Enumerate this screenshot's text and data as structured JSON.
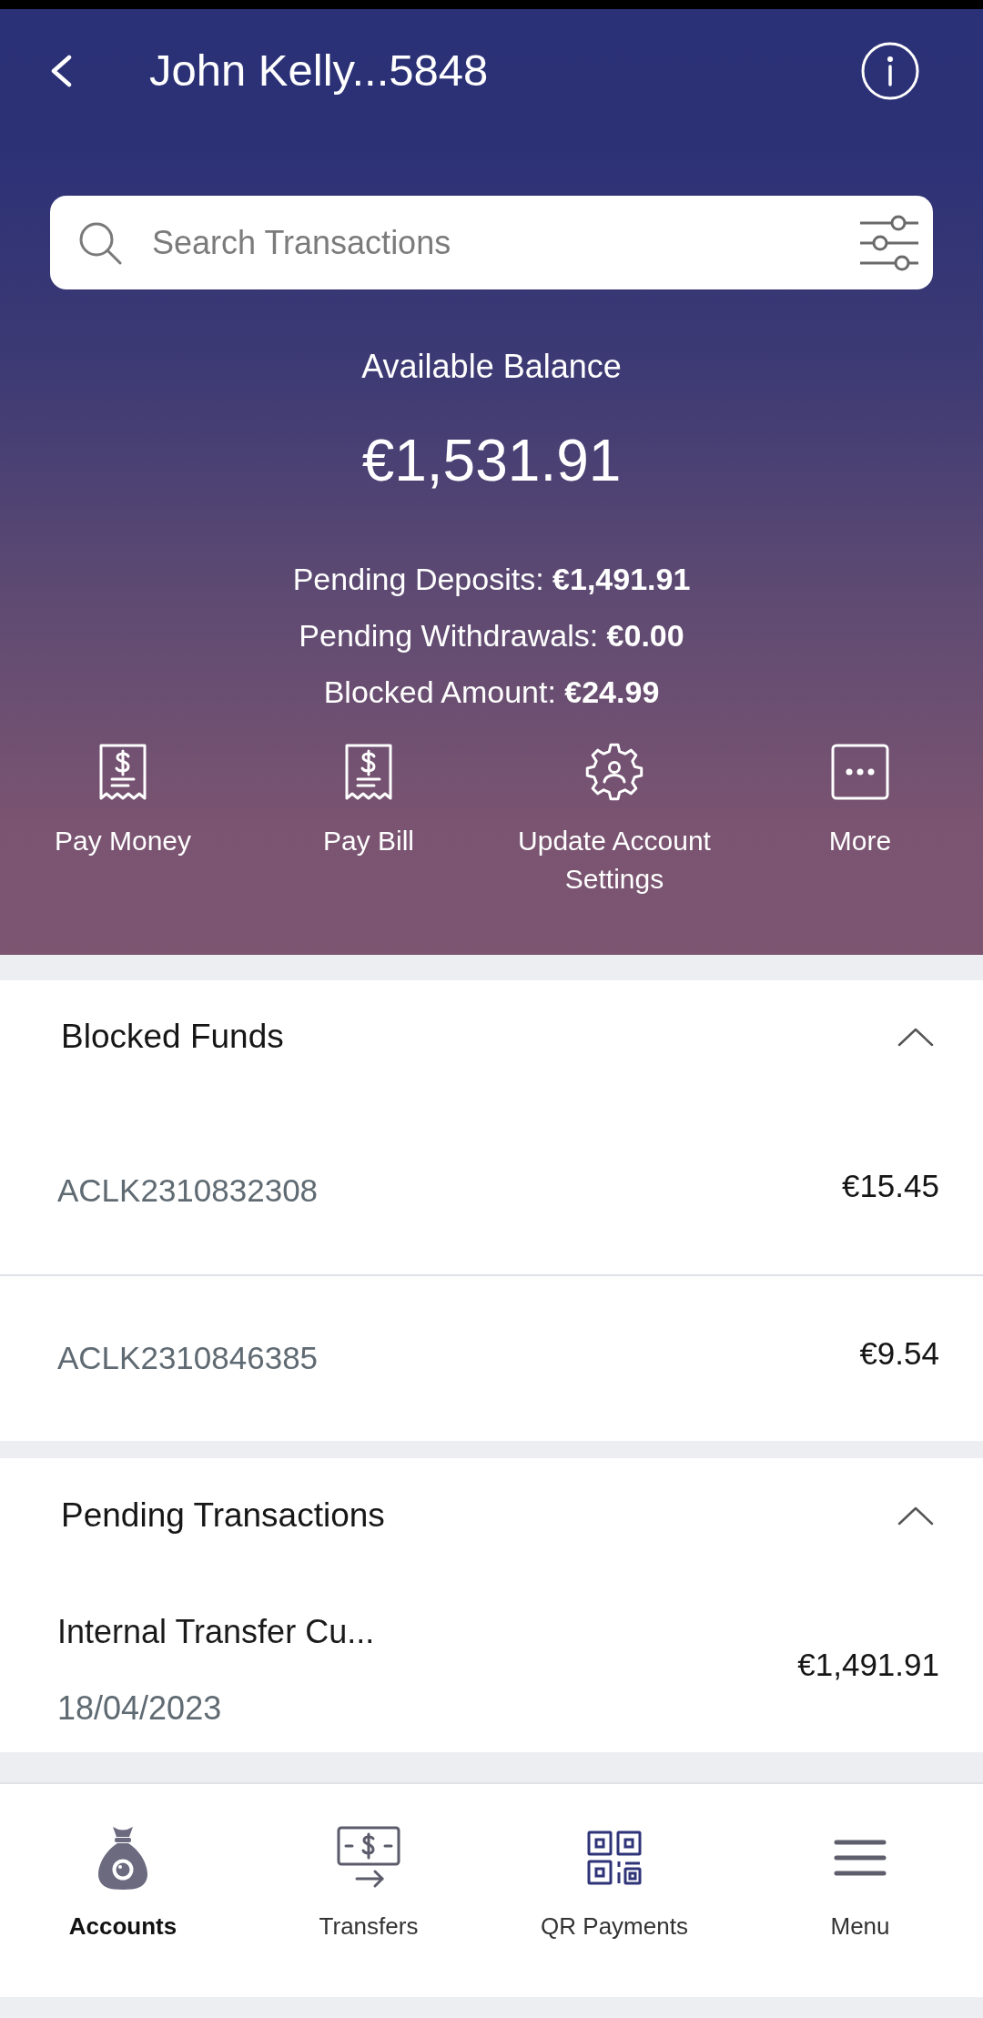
{
  "header": {
    "title": "John Kelly...5848"
  },
  "search": {
    "placeholder": "Search Transactions"
  },
  "balance": {
    "label": "Available Balance",
    "amount": "€1,531.91",
    "details": [
      "Pending Deposits: **€1,491.91**",
      "Pending Withdrawals: **€0.00**",
      "Blocked Amount: **€24.99**"
    ]
  },
  "actions": [
    {
      "kind": "payment",
      "label": "Pay Money"
    },
    {
      "kind": "payment",
      "label": "Pay Bill"
    },
    {
      "kind": "settings",
      "label": "Update Account Settings"
    },
    {
      "kind": "more",
      "label": "More"
    }
  ],
  "sections": [
    {
      "kind": "blocked",
      "title": "Blocked Funds",
      "expanded": true,
      "items": [
        {
          "reference": "ACLK2310832308",
          "amount": "€15.45"
        },
        {
          "reference": "ACLK2310846385",
          "amount": "€9.54"
        }
      ]
    },
    {
      "kind": "pending",
      "title": "Pending Transactions",
      "expanded": true,
      "items": [
        {
          "description": "Internal Transfer Cu...",
          "date": "18/04/2023",
          "amount": "€1,491.91"
        }
      ]
    }
  ],
  "bottom_nav": [
    {
      "kind": "accounts",
      "label": "Accounts",
      "selected": true
    },
    {
      "kind": "transfers",
      "label": "Transfers",
      "selected": false
    },
    {
      "kind": "qr",
      "label": "QR Payments",
      "selected": false
    },
    {
      "kind": "menu",
      "label": "Menu",
      "selected": false
    }
  ]
}
